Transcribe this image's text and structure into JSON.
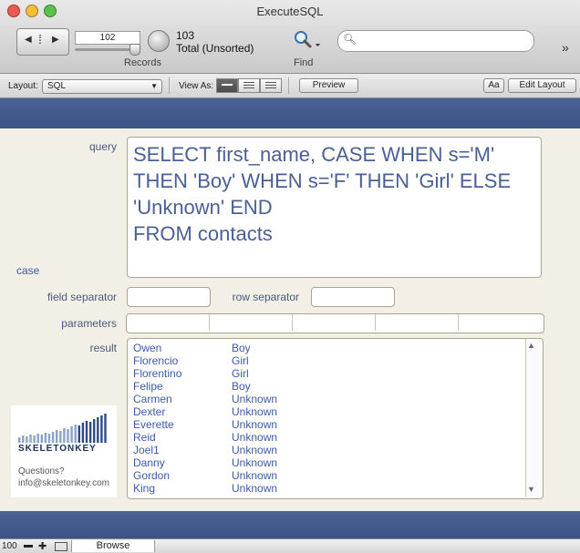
{
  "window": {
    "title": "ExecuteSQL"
  },
  "toolbar": {
    "current_record": "102",
    "total_count": "103",
    "total_label": "Total (Unsorted)",
    "records_label": "Records",
    "find_label": "Find",
    "search_placeholder": "",
    "record_slider_fraction": 0.99
  },
  "layoutbar": {
    "layout_label": "Layout:",
    "layout_value": "SQL",
    "view_as_label": "View As:",
    "preview_label": "Preview",
    "aa_label": "Aa",
    "edit_layout_label": "Edit Layout"
  },
  "form": {
    "query_label": "query",
    "query_lines": [
      "SELECT first_name, CASE WHEN s='M'",
      "THEN 'Boy' WHEN s='F' THEN 'Girl' ELSE",
      "'Unknown' END",
      "FROM contacts"
    ],
    "case_label": "case",
    "field_separator_label": "field separator",
    "row_separator_label": "row separator",
    "parameters_label": "parameters",
    "result_label": "result",
    "result_rows": [
      [
        "Owen",
        "Boy"
      ],
      [
        "Florencio",
        "Girl"
      ],
      [
        "Florentino",
        "Girl"
      ],
      [
        "Felipe",
        "Boy"
      ],
      [
        "Carmen",
        "Unknown"
      ],
      [
        "Dexter",
        "Unknown"
      ],
      [
        "Everette",
        "Unknown"
      ],
      [
        "Reid",
        "Unknown"
      ],
      [
        "Joel1",
        "Unknown"
      ],
      [
        "Danny",
        "Unknown"
      ],
      [
        "Gordon",
        "Unknown"
      ],
      [
        "King",
        "Unknown"
      ]
    ]
  },
  "logo": {
    "brand": "SKELETONKEY",
    "questions": "Questions?",
    "email": "info@skeletonkey.com"
  },
  "status": {
    "zoom": "100",
    "mode": "Browse"
  },
  "colors": {
    "band": "#3c5485",
    "content_bg": "#f2efe6",
    "text_blue": "#3d5aa6"
  }
}
